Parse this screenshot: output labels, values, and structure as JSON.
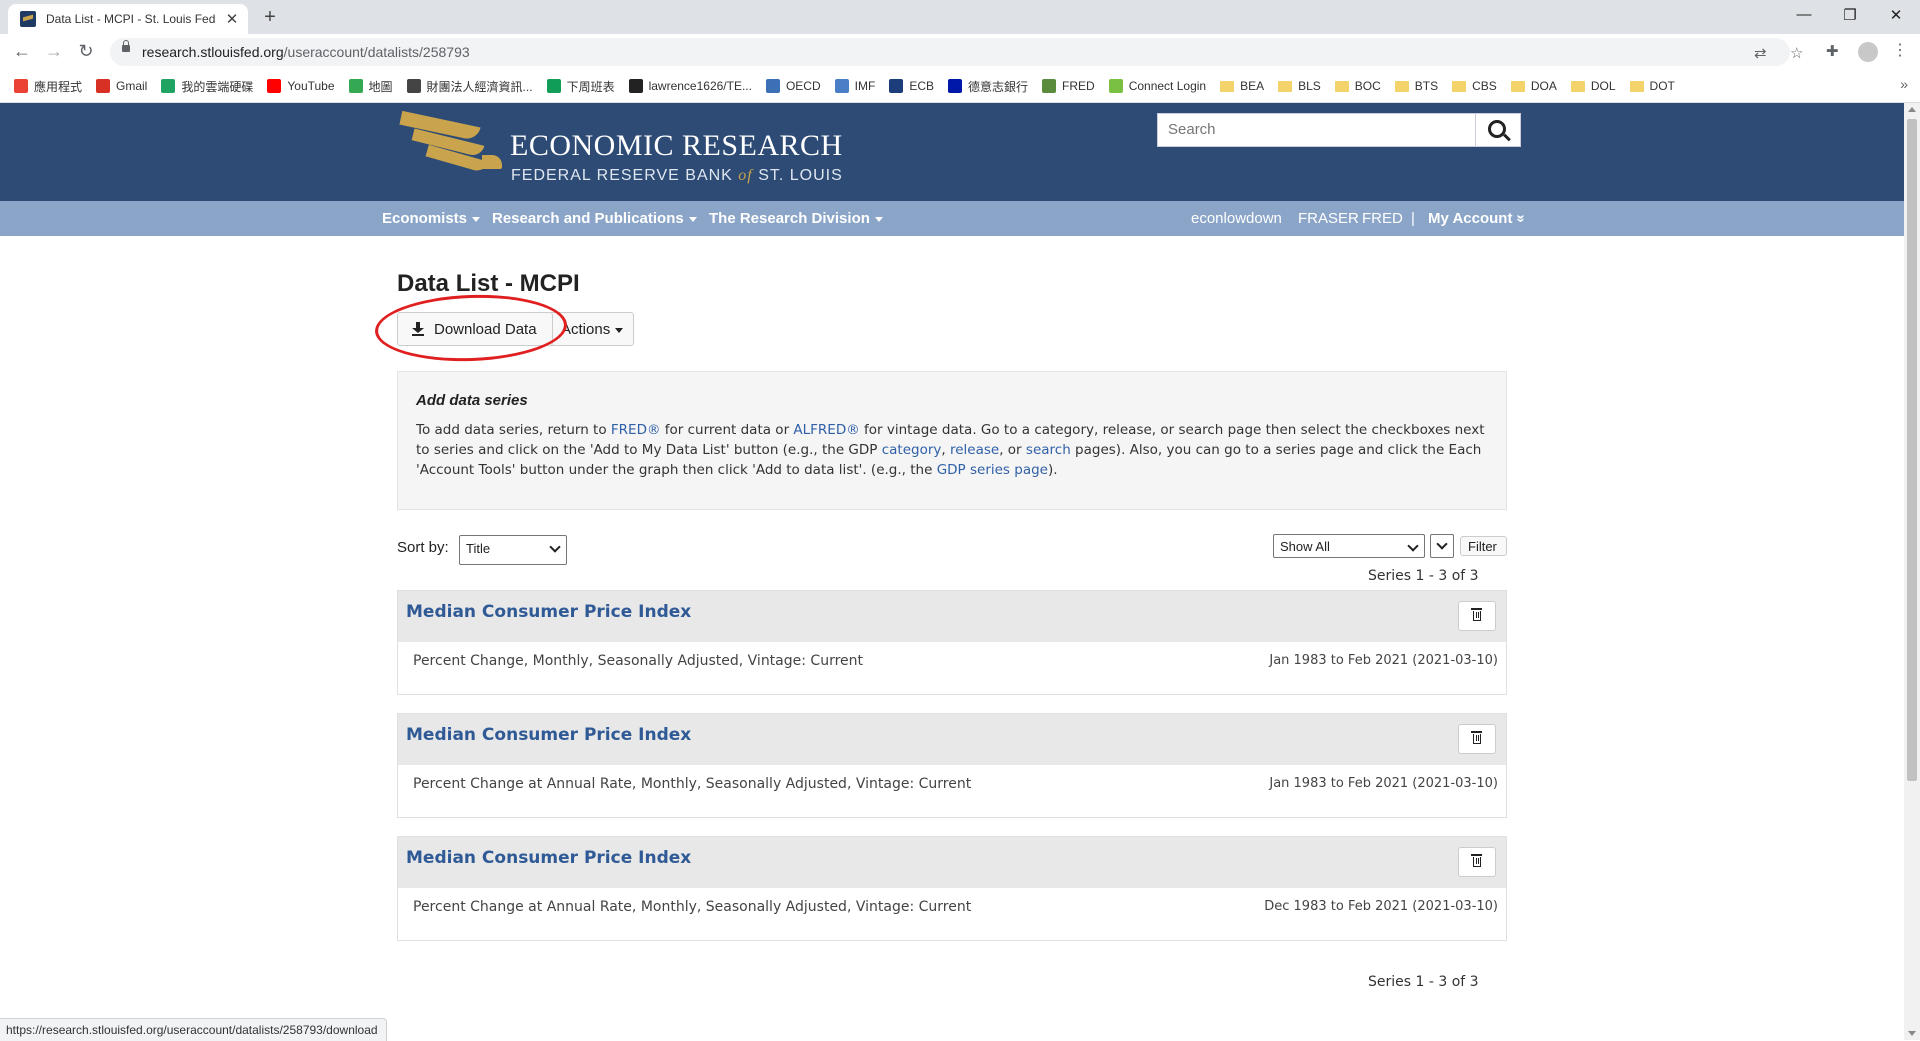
{
  "browser": {
    "tab_title": "Data List - MCPI - St. Louis Fed",
    "new_tab": "+",
    "close_tab": "✕",
    "window_controls": {
      "minimize": "—",
      "maximize": "❐",
      "close": "✕"
    },
    "url_host": "research.stlouisfed.org",
    "url_path": "/useraccount/datalists/258793",
    "bookmarks": [
      {
        "label": "應用程式",
        "icon": "apps-icon",
        "color": "#ea4335"
      },
      {
        "label": "Gmail",
        "icon": "gmail-icon",
        "color": "#d93025"
      },
      {
        "label": "我的雲端硬碟",
        "icon": "drive-icon",
        "color": "#1fa463"
      },
      {
        "label": "YouTube",
        "icon": "youtube-icon",
        "color": "#ff0000"
      },
      {
        "label": "地圖",
        "icon": "maps-icon",
        "color": "#34a853"
      },
      {
        "label": "財團法人經濟資訊...",
        "icon": "globe-icon",
        "color": "#444444"
      },
      {
        "label": "下周班表",
        "icon": "sheets-icon",
        "color": "#0f9d58"
      },
      {
        "label": "lawrence1626/TE...",
        "icon": "github-icon",
        "color": "#222222"
      },
      {
        "label": "OECD",
        "icon": "oecd-icon",
        "color": "#3b6fb6"
      },
      {
        "label": "IMF",
        "icon": "imf-icon",
        "color": "#4a7ec7"
      },
      {
        "label": "ECB",
        "icon": "ecb-icon",
        "color": "#1b3d7a"
      },
      {
        "label": "德意志銀行",
        "icon": "db-icon",
        "color": "#0018a8"
      },
      {
        "label": "FRED",
        "icon": "fred-icon",
        "color": "#5b8c3e"
      },
      {
        "label": "Connect Login",
        "icon": "connect-icon",
        "color": "#7ac143"
      },
      {
        "label": "BEA",
        "icon": "folder-icon"
      },
      {
        "label": "BLS",
        "icon": "folder-icon"
      },
      {
        "label": "BOC",
        "icon": "folder-icon"
      },
      {
        "label": "BTS",
        "icon": "folder-icon"
      },
      {
        "label": "CBS",
        "icon": "folder-icon"
      },
      {
        "label": "DOA",
        "icon": "folder-icon"
      },
      {
        "label": "DOL",
        "icon": "folder-icon"
      },
      {
        "label": "DOT",
        "icon": "folder-icon"
      }
    ],
    "bookmarks_more": "»",
    "status_url": "https://research.stlouisfed.org/useraccount/datalists/258793/download"
  },
  "site": {
    "logo_line1": "ECONOMIC RESEARCH",
    "logo_line2_a": "FEDERAL RESERVE BANK ",
    "logo_line2_of": "of",
    "logo_line2_b": " ST. LOUIS",
    "search_placeholder": "Search",
    "nav_left": [
      "Economists",
      "Research and Publications",
      "The Research Division"
    ],
    "nav_right": [
      "econlowdown",
      "FRASER",
      "FRED"
    ],
    "nav_separator": "|",
    "my_account": "My Account",
    "my_account_icon": "»"
  },
  "page": {
    "title": "Data List - MCPI",
    "download_label": "Download Data",
    "actions_label": "Actions",
    "info_heading": "Add data series",
    "info_text_1": "To add data series, return to ",
    "info_link_fred": "FRED®",
    "info_text_2": " for current data or ",
    "info_link_alfred": "ALFRED®",
    "info_text_3": " for vintage data. Go to a category, release, or search page then select the checkboxes next to series and click on the 'Add to My Data List' button (e.g., the GDP ",
    "info_link_category": "category",
    "info_text_4": ", ",
    "info_link_release": "release",
    "info_text_5": ", or ",
    "info_link_search": "search",
    "info_text_6": " pages). Also, you can go to a series page and click the Each 'Account Tools' button under the graph then click 'Add to data list'. (e.g., the ",
    "info_link_series": "GDP series page",
    "info_text_7": ").",
    "sort_label": "Sort by:",
    "sort_value": "Title",
    "show_value": "Show All",
    "filter_label": "Filter",
    "series_count_top": "Series 1 - 3 of 3",
    "series_count_bottom": "Series 1 - 3 of 3",
    "series": [
      {
        "title": "Median Consumer Price Index",
        "desc": "Percent Change, Monthly, Seasonally Adjusted, Vintage: Current",
        "range": "Jan 1983 to Feb 2021 (2021-03-10)"
      },
      {
        "title": "Median Consumer Price Index",
        "desc": "Percent Change at Annual Rate, Monthly, Seasonally Adjusted, Vintage: Current",
        "range": "Jan 1983 to Feb 2021 (2021-03-10)"
      },
      {
        "title": "Median Consumer Price Index",
        "desc": "Percent Change at Annual Rate, Monthly, Seasonally Adjusted, Vintage: Current",
        "range": "Dec 1983 to Feb 2021 (2021-03-10)"
      }
    ]
  },
  "colors": {
    "header_bg": "#2d4b75",
    "nav_bg": "#8aa5c8",
    "link": "#2f5a96",
    "annotation": "#e02020",
    "logo_gold": "#c9a44c"
  }
}
